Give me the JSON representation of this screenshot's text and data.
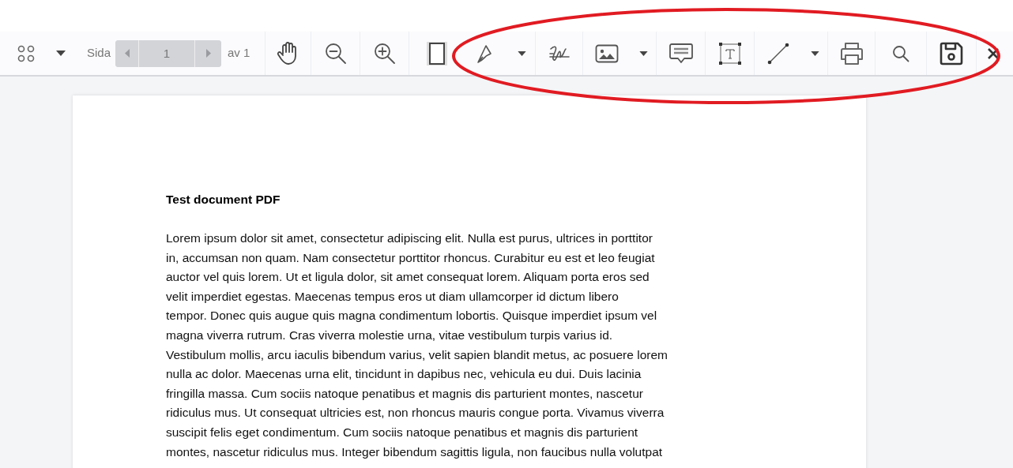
{
  "toolbar": {
    "page_label": "Sida",
    "page_value": "1",
    "page_total": "av 1"
  },
  "document": {
    "title": "Test document PDF",
    "lines": [
      "Lorem ipsum dolor sit amet, consectetur adipiscing elit. Nulla est purus, ultrices in porttitor",
      "in, accumsan non quam. Nam consectetur porttitor rhoncus. Curabitur eu est et leo feugiat",
      "auctor vel quis lorem. Ut et ligula dolor, sit amet consequat lorem. Aliquam porta eros sed",
      "velit imperdiet egestas. Maecenas tempus eros ut diam ullamcorper id dictum libero",
      "tempor. Donec quis augue quis magna condimentum lobortis. Quisque imperdiet ipsum vel",
      "magna viverra rutrum. Cras viverra molestie urna, vitae vestibulum turpis varius id.",
      "Vestibulum mollis, arcu iaculis bibendum varius, velit sapien blandit metus, ac posuere lorem",
      "nulla ac dolor. Maecenas urna elit, tincidunt in dapibus nec, vehicula eu dui. Duis lacinia",
      "fringilla massa. Cum sociis natoque penatibus et magnis dis parturient montes, nascetur",
      "ridiculus mus. Ut consequat ultricies est, non rhoncus mauris congue porta. Vivamus viverra",
      "suscipit felis eget condimentum. Cum sociis natoque penatibus et magnis dis parturient",
      "montes, nascetur ridiculus mus. Integer bibendum sagittis ligula, non faucibus nulla volutpat"
    ]
  }
}
